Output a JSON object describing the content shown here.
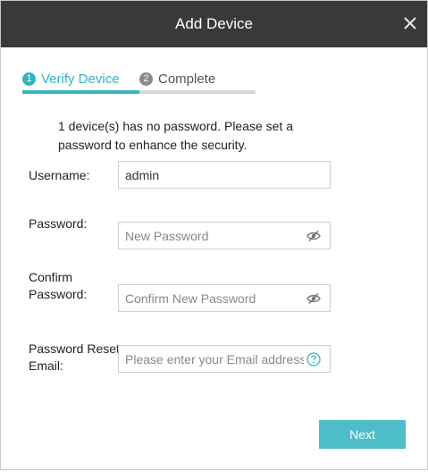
{
  "dialog": {
    "title": "Add Device",
    "close_icon": "close-icon"
  },
  "steps": [
    {
      "number": "1",
      "label": "Verify Device",
      "state": "active"
    },
    {
      "number": "2",
      "label": "Complete",
      "state": "pending"
    }
  ],
  "colors": {
    "accent": "#35b3c1",
    "titlebar": "#393939",
    "button": "#4dbdc7"
  },
  "notice": "1 device(s) has no password. Please set a password to enhance the security.",
  "form": {
    "username": {
      "label": "Username:",
      "value": "admin"
    },
    "password": {
      "label": "Password:",
      "placeholder": "New Password",
      "icon": "eye-hidden-icon"
    },
    "confirm_password": {
      "label_line1": "Confirm",
      "label_line2": "Password:",
      "placeholder": "Confirm New Password",
      "icon": "eye-hidden-icon"
    },
    "reset_email": {
      "label_line1": "Password Reset",
      "label_line2": "Email:",
      "placeholder": "Please enter your Email address",
      "icon": "help-icon"
    }
  },
  "buttons": {
    "next": "Next"
  }
}
